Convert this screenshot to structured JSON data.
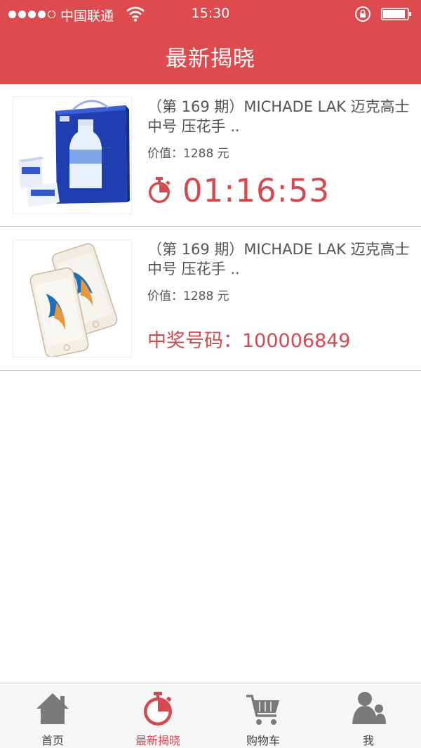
{
  "status_bar": {
    "carrier": "中国联通",
    "time": "15:30"
  },
  "nav": {
    "title": "最新揭晓"
  },
  "items": [
    {
      "title": "（第 169 期）MICHADE LAK 迈克高士  中号 压花手 ..",
      "price": "价值：1288 元",
      "countdown": "01:16:53",
      "image": "milk-gift-box"
    },
    {
      "title": "（第 169 期）MICHADE LAK 迈克高士  中号 压花手 ..",
      "price": "价值：1288 元",
      "winner": "中奖号码：100006849",
      "image": "smartphones"
    }
  ],
  "tabs": [
    {
      "label": "首页",
      "icon": "home-icon"
    },
    {
      "label": "最新揭晓",
      "icon": "stopwatch-icon",
      "active": true
    },
    {
      "label": "购物车",
      "icon": "cart-icon"
    },
    {
      "label": "我",
      "icon": "user-icon"
    }
  ],
  "colors": {
    "brand": "#de4b4f",
    "accent_text": "#d5484d",
    "tab_inactive": "#7a7a7a"
  }
}
